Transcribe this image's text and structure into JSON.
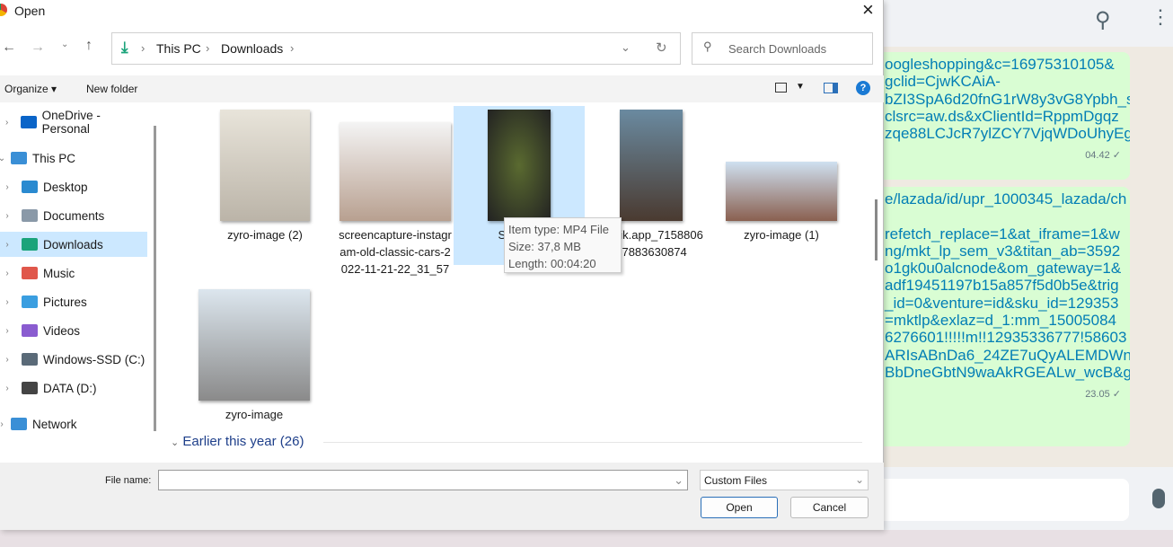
{
  "dialog": {
    "title": "Open",
    "close_icon": "×",
    "nav": {
      "path": [
        "This PC",
        "Downloads"
      ],
      "search_placeholder": "Search Downloads"
    },
    "toolbar": {
      "organize": "Organize",
      "new_folder": "New folder"
    },
    "sidebar": [
      {
        "label": "OneDrive - Personal",
        "icon": "cloud-icon",
        "color": "#0a64c8"
      },
      {
        "label": "This PC",
        "icon": "pc-icon",
        "color": "#3a8fd6"
      },
      {
        "label": "Desktop",
        "icon": "desktop-icon",
        "color": "#2a8ad0"
      },
      {
        "label": "Documents",
        "icon": "documents-icon",
        "color": "#8a99a8"
      },
      {
        "label": "Downloads",
        "icon": "download-icon",
        "color": "#1ba37a",
        "selected": true
      },
      {
        "label": "Music",
        "icon": "music-icon",
        "color": "#e0574b"
      },
      {
        "label": "Pictures",
        "icon": "pictures-icon",
        "color": "#3a9ee0"
      },
      {
        "label": "Videos",
        "icon": "videos-icon",
        "color": "#8a5cd0"
      },
      {
        "label": "Windows-SSD (C:)",
        "icon": "drive-icon",
        "color": "#5a6a78"
      },
      {
        "label": "DATA (D:)",
        "icon": "drive-icon",
        "color": "#444"
      },
      {
        "label": "Network",
        "icon": "network-icon",
        "color": "#3a8fd6"
      }
    ],
    "files": [
      {
        "name": "zyro-image (2)"
      },
      {
        "name": "screencapture-instagram-old-classic-cars-2022-11-21-22_31_57",
        "lines": [
          "screencapture-instagr",
          "am-old-classic-cars-2",
          "022-11-21-22_31_57"
        ]
      },
      {
        "lines": [
          "Snaptik.",
          "4530"
        ],
        "selected": true
      },
      {
        "lines": [
          "ssstik.app_7158806",
          "97883630874"
        ]
      },
      {
        "name": "zyro-image (1)"
      },
      {
        "name": "zyro-image"
      }
    ],
    "group_header": "Earlier this year (26)",
    "tooltip": {
      "type": "Item type: MP4 File",
      "size": "Size: 37,8 MB",
      "length": "Length: 00:04:20"
    },
    "file_name_label": "File name:",
    "file_name_value": "",
    "file_type": "Custom Files",
    "open": "Open",
    "cancel": "Cancel"
  },
  "chat": {
    "msg1": {
      "lines": [
        "oogleshopping&c=16975310105&",
        "gclid=CjwKCAiA-",
        "bZI3SpA6d20fnG1rW8y3vG8Ypbh_s",
        "clsrc=aw.ds&xClientId=RppmDgqz",
        "zqe88LCJcR7ylZCY7VjqWDoUhyEgy"
      ],
      "time": "04.42 ✓"
    },
    "msg2": {
      "lines": [
        "e/lazada/id/upr_1000345_lazada/ch",
        "",
        "refetch_replace=1&at_iframe=1&w",
        "ng/mkt_lp_sem_v3&titan_ab=3592",
        "o1gk0u0alcnode&om_gateway=1&",
        "adf19451197b15a857f5d0b5e&trig",
        "_id=0&venture=id&sku_id=129353",
        "=mktlp&exlaz=d_1:mm_15005084",
        "6276601!!!!!m!!12935336777!58603",
        "ARIsABnDa6_24ZE7uQyALEMDWn0",
        "BbDneGbtN9waAkRGEALw_wcB&gt"
      ],
      "time": "23.05 ✓"
    }
  }
}
